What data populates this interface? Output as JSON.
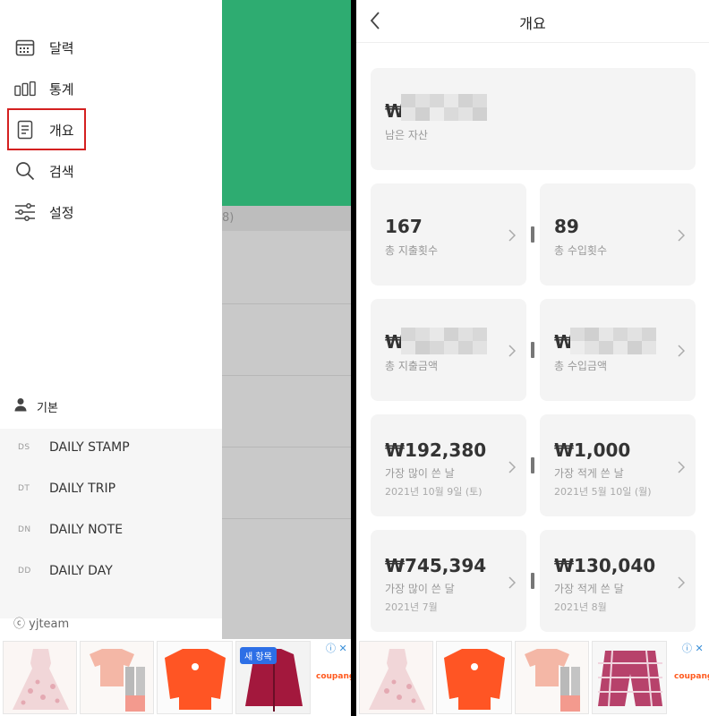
{
  "drawer": {
    "menu": [
      {
        "label": "달력",
        "icon": "calendar-icon"
      },
      {
        "label": "통계",
        "icon": "bar-chart-icon"
      },
      {
        "label": "개요",
        "icon": "document-icon"
      },
      {
        "label": "검색",
        "icon": "search-icon"
      },
      {
        "label": "설정",
        "icon": "sliders-icon"
      }
    ],
    "profile": "기본",
    "apps": [
      {
        "abbr": "DS",
        "name": "DAILY STAMP"
      },
      {
        "abbr": "DT",
        "name": "DAILY TRIP"
      },
      {
        "abbr": "DN",
        "name": "DAILY NOTE"
      },
      {
        "abbr": "DD",
        "name": "DAILY DAY"
      }
    ],
    "credit": "ⓒ yjteam"
  },
  "background": {
    "partial_text": "8)"
  },
  "ads": {
    "left_badge": "새 항목",
    "brand": "coupang",
    "close": "ⓘ ✕"
  },
  "overview": {
    "title": "개요",
    "remaining_assets": {
      "currency": "₩",
      "label": "남은 자산"
    },
    "total_expense_count": {
      "value": "167",
      "label": "총 지출횟수"
    },
    "total_income_count": {
      "value": "89",
      "label": "총 수입횟수"
    },
    "total_expense_amount": {
      "currency": "₩",
      "label": "총 지출금액"
    },
    "total_income_amount": {
      "currency": "₩",
      "label": "총 수입금액"
    },
    "most_spent_day": {
      "value": "₩192,380",
      "label": "가장 많이 쓴 날",
      "date": "2021년 10월 9일 (토)"
    },
    "least_spent_day": {
      "value": "₩1,000",
      "label": "가장 적게 쓴 날",
      "date": "2021년 5월 10일 (월)"
    },
    "most_spent_month": {
      "value": "₩745,394",
      "label": "가장 많이 쓴 달",
      "date": "2021년 7월"
    },
    "least_spent_month": {
      "value": "₩130,040",
      "label": "가장 적게 쓴 달",
      "date": "2021년 8월"
    }
  },
  "colors": {
    "accent_green": "#2eac71",
    "highlight_red": "#d42020"
  }
}
